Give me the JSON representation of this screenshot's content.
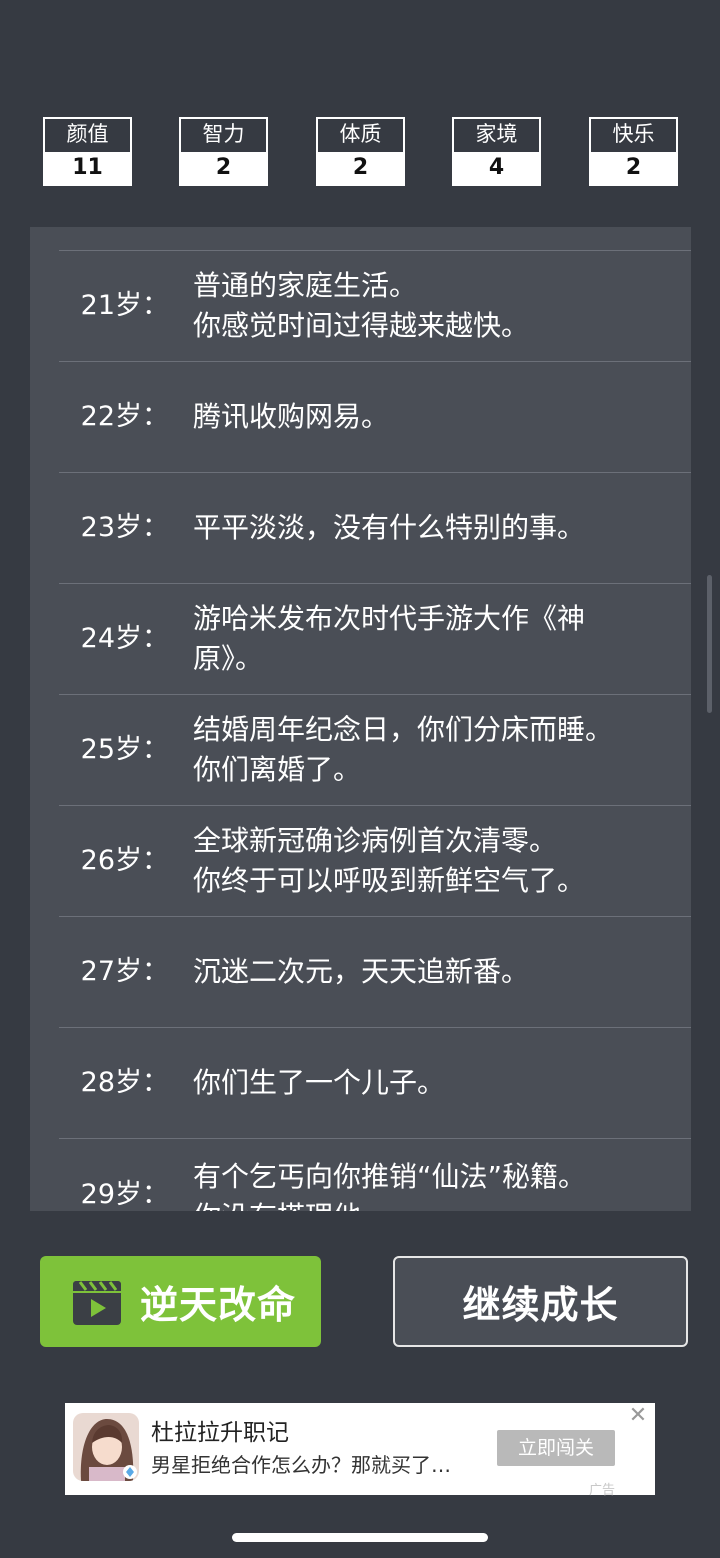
{
  "stats": [
    {
      "label": "颜值",
      "value": "11"
    },
    {
      "label": "智力",
      "value": "2"
    },
    {
      "label": "体质",
      "value": "2"
    },
    {
      "label": "家境",
      "value": "4"
    },
    {
      "label": "快乐",
      "value": "2"
    }
  ],
  "events": [
    {
      "age": "21岁：",
      "lines": [
        "普通的家庭生活。",
        "你感觉时间过得越来越快。"
      ]
    },
    {
      "age": "22岁：",
      "lines": [
        "腾讯收购网易。"
      ]
    },
    {
      "age": "23岁：",
      "lines": [
        "平平淡淡，没有什么特别的事。"
      ]
    },
    {
      "age": "24岁：",
      "lines": [
        "游哈米发布次时代手游大作《神",
        "原》。"
      ]
    },
    {
      "age": "25岁：",
      "lines": [
        "结婚周年纪念日，你们分床而睡。",
        "你们离婚了。"
      ]
    },
    {
      "age": "26岁：",
      "lines": [
        "全球新冠确诊病例首次清零。",
        "你终于可以呼吸到新鲜空气了。"
      ]
    },
    {
      "age": "27岁：",
      "lines": [
        "沉迷二次元，天天追新番。"
      ]
    },
    {
      "age": "28岁：",
      "lines": [
        "你们生了一个儿子。"
      ]
    },
    {
      "age": "29岁：",
      "lines": [
        "有个乞丐向你推销“仙法”秘籍。",
        "你没有搭理他。"
      ]
    }
  ],
  "buttons": {
    "reroll": "逆天改命",
    "continue": "继续成长"
  },
  "ad": {
    "title": "杜拉拉升职记",
    "subtitle": "男星拒绝合作怎么办？那就买了…",
    "cta": "立即闯关",
    "close": "✕",
    "tag": "广告"
  },
  "colors": {
    "background": "#363a42",
    "panel": "#4a4e56",
    "green_button": "#7ec23a"
  }
}
